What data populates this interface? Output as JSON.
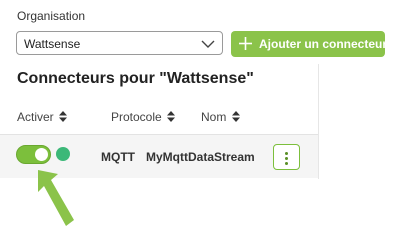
{
  "organisation": {
    "label": "Organisation",
    "selected": "Wattsense"
  },
  "toolbar": {
    "add_label": "Ajouter un connecteur",
    "add_icon": "plus-icon"
  },
  "connectors": {
    "title": "Connecteurs pour \"Wattsense\"",
    "columns": [
      "Activer",
      "Protocole",
      "Nom"
    ],
    "rows": [
      {
        "enabled": true,
        "status": "connected",
        "protocol": "MQTT",
        "name": "MyMqttDataStream"
      }
    ]
  },
  "colors": {
    "accent": "#8bc34a",
    "toggle_on": "#7cbf3c",
    "status_ok": "#3cb878"
  }
}
